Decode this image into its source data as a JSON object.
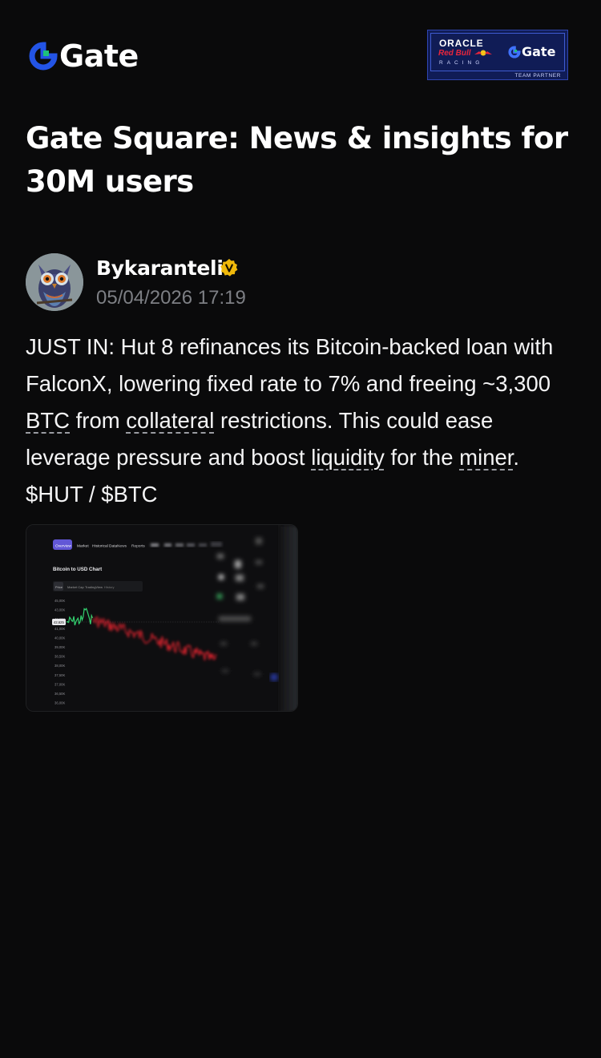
{
  "header": {
    "logo_text": "Gate",
    "brand_color": "#2354e6",
    "partner_badge": {
      "oracle": "ORACLE",
      "redbull": "Red Bull",
      "racing": "RACING",
      "gate_text": "Gate",
      "team_partner": "TEAM PARTNER"
    }
  },
  "page": {
    "title": "Gate Square: News & insights for 30M users"
  },
  "post": {
    "author": "Bykaranteli",
    "verified_icon": "verified-badge-icon",
    "verified_color": "#f0b90b",
    "timestamp": "05/04/2026 17:19",
    "body": {
      "t1": "JUST IN: Hut 8 refinances its Bitcoin-backed loan with FalconX, lowering fixed rate to 7% and freeing ~3,300 ",
      "tag1": "BTC",
      "t2": " from ",
      "tag2": "collateral",
      "t3": " restrictions. This could ease leverage pressure and boost ",
      "tag3": "liquidity",
      "t4": " for the ",
      "tag4": "miner",
      "t5": ". $HUT / $BTC"
    },
    "image": {
      "tab_overview": "Overview",
      "tab_market": "Market",
      "tab_historical": "Historical Data",
      "tab_news": "News",
      "tab_reports": "Reports",
      "chart_title": "Bitcoin to USD Chart",
      "filter_price": "Price",
      "filter_mcap": "Market Cap",
      "filter_tv": "TradingView",
      "filter_more": "History",
      "price_tag": "42,625",
      "y_labels": [
        "45,00K",
        "43,00K",
        "42,60K",
        "41,00K",
        "40,00K",
        "39,00K",
        "38,50K",
        "38,00K",
        "37,50K",
        "37,00K",
        "36,50K",
        "36,00K"
      ],
      "up_color": "#33d16f",
      "down_color": "#e5242f"
    }
  }
}
